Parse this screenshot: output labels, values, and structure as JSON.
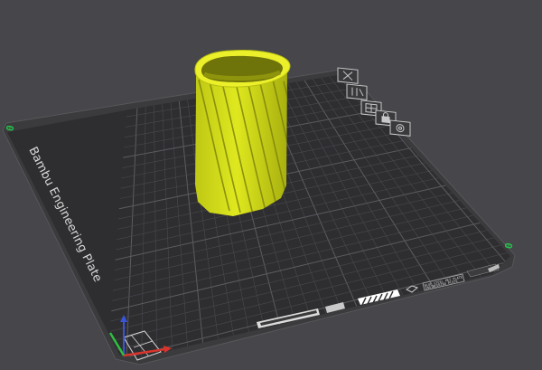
{
  "viewport": {
    "background_color": "#46464b",
    "bed": {
      "plate_label": "Bambu Engineering Plate",
      "origin_marker_left": "0",
      "origin_marker_right": "0",
      "plate_color": "#2d2d30",
      "grid_color": "#4a4a4e",
      "strip_text_1": "BLUE STEEL PEI PLATE",
      "strip_text_2": "ENGINEERING PLATE"
    },
    "model": {
      "name": "twisted vase",
      "color": "#d8e218"
    },
    "axes": {
      "x_color": "#d9342b",
      "y_color": "#2fbf3f",
      "z_color": "#3a54d8"
    },
    "corner_icons": [
      "close-icon",
      "compare-icon",
      "grid-icon",
      "lock-icon",
      "gear-icon"
    ]
  }
}
